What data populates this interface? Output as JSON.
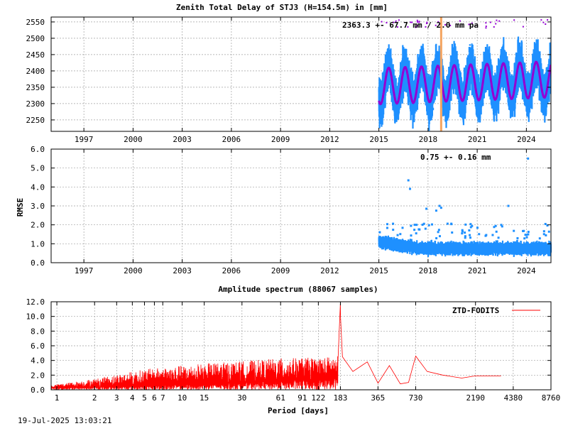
{
  "footer_timestamp": "19-Jul-2025 13:03:21",
  "chart_data": [
    {
      "id": "ztd",
      "type": "scatter",
      "title": "Zenith Total Delay of STJ3 (H=154.5m) in [mm]",
      "xlabel": "",
      "ylabel": "",
      "xlim": [
        1995.0,
        2025.5
      ],
      "ylim": [
        2215,
        2565
      ],
      "x_ticks": [
        1997,
        2000,
        2003,
        2006,
        2009,
        2012,
        2015,
        2018,
        2021,
        2024
      ],
      "x_tick_labels": [
        "1997",
        "2000",
        "2003",
        "2006",
        "2009",
        "2012",
        "2015",
        "2018",
        "2021",
        "2024"
      ],
      "y_ticks": [
        2250,
        2300,
        2350,
        2400,
        2450,
        2500,
        2550
      ],
      "y_tick_labels": [
        "2250",
        "2300",
        "2350",
        "2400",
        "2450",
        "2500",
        "2550"
      ],
      "grid": true,
      "annotation": "2363.3 +-  67.7 mm /  2.0 mm pa",
      "marker_line_year": 2018.8,
      "colors": {
        "points": "#1e90ff",
        "model": "#9400d3",
        "marker": "#f4a460"
      },
      "series": [
        {
          "role": "observations",
          "x_start": 2015.0,
          "x_end": 2025.5,
          "mean": 2363.3,
          "std": 67.7,
          "seasonal_amplitude": 50,
          "trend_mm_per_year": 2.0,
          "peak_phase_year_fraction": 0.6
        },
        {
          "role": "seasonal-model",
          "x_start": 2015.0,
          "x_end": 2025.5,
          "mean": 2363.3,
          "seasonal_amplitude": 55,
          "trend_mm_per_year": 2.0,
          "peak_phase_year_fraction": 0.6
        }
      ]
    },
    {
      "id": "rmse",
      "type": "scatter",
      "title": "",
      "xlabel": "",
      "ylabel": "RMSE",
      "xlim": [
        1995.0,
        2025.5
      ],
      "ylim": [
        0.0,
        6.0
      ],
      "x_ticks": [
        1997,
        2000,
        2003,
        2006,
        2009,
        2012,
        2015,
        2018,
        2021,
        2024
      ],
      "x_tick_labels": [
        "1997",
        "2000",
        "2003",
        "2006",
        "2009",
        "2012",
        "2015",
        "2018",
        "2021",
        "2024"
      ],
      "y_ticks": [
        0.0,
        1.0,
        2.0,
        3.0,
        4.0,
        5.0,
        6.0
      ],
      "y_tick_labels": [
        "0.0",
        "1.0",
        "2.0",
        "3.0",
        "4.0",
        "5.0",
        "6.0"
      ],
      "grid": true,
      "annotation": "0.75 +-  0.16 mm",
      "colors": {
        "points": "#1e90ff"
      },
      "series": [
        {
          "role": "rmse",
          "x_start": 2015.0,
          "x_end": 2025.5,
          "mean": 0.75,
          "std": 0.16,
          "outliers": [
            [
              2016.8,
              4.35
            ],
            [
              2016.9,
              3.9
            ],
            [
              2017.3,
              2.0
            ],
            [
              2017.9,
              2.85
            ],
            [
              2018.5,
              2.75
            ],
            [
              2018.7,
              3.0
            ],
            [
              2018.8,
              2.9
            ],
            [
              2022.9,
              3.0
            ],
            [
              2024.1,
              5.5
            ]
          ]
        }
      ]
    },
    {
      "id": "spectrum",
      "type": "line",
      "title": "Amplitude spectrum (88067 samples)",
      "xlabel": "Period [days]",
      "ylabel": "",
      "xscale": "log",
      "xlim": [
        0.9,
        8760
      ],
      "ylim": [
        0.0,
        12.0
      ],
      "x_ticks": [
        1,
        2,
        3,
        4,
        5,
        6,
        7,
        10,
        15,
        30,
        61,
        91,
        122,
        183,
        365,
        730,
        2190,
        4380,
        8760
      ],
      "x_tick_labels": [
        "1",
        "2",
        "3",
        "4",
        "5",
        "6",
        "7",
        "10",
        "15",
        "30",
        "61",
        "91",
        "122",
        "183",
        "365",
        "730",
        "2190",
        "4380",
        "8760"
      ],
      "y_ticks": [
        0.0,
        2.0,
        4.0,
        6.0,
        8.0,
        10.0,
        12.0
      ],
      "y_tick_labels": [
        "0.0",
        "2.0",
        "4.0",
        "6.0",
        "8.0",
        "10.0",
        "12.0"
      ],
      "grid": true,
      "legend_position": "top-right",
      "colors": {
        "line": "#ff0000"
      },
      "series": [
        {
          "name": "ZTD-FODITS",
          "envelope": [
            [
              0.9,
              0.3,
              0.6
            ],
            [
              2,
              0.4,
              1.5
            ],
            [
              5,
              0.5,
              2.8
            ],
            [
              15,
              0.8,
              3.6
            ],
            [
              30,
              1.0,
              3.9
            ],
            [
              60,
              1.2,
              4.3
            ],
            [
              120,
              1.4,
              4.4
            ],
            [
              175,
              1.6,
              4.6
            ]
          ],
          "peaks": [
            [
              183,
              11.8
            ],
            [
              183.5,
              10.0
            ],
            [
              190,
              4.5
            ],
            [
              230,
              2.5
            ],
            [
              300,
              3.8
            ],
            [
              365,
              0.9
            ],
            [
              450,
              3.3
            ],
            [
              550,
              0.8
            ],
            [
              640,
              1.0
            ],
            [
              730,
              4.6
            ],
            [
              900,
              2.5
            ],
            [
              1200,
              2.0
            ],
            [
              1700,
              1.6
            ],
            [
              2190,
              1.9
            ],
            [
              3500,
              1.9
            ]
          ]
        }
      ]
    }
  ]
}
